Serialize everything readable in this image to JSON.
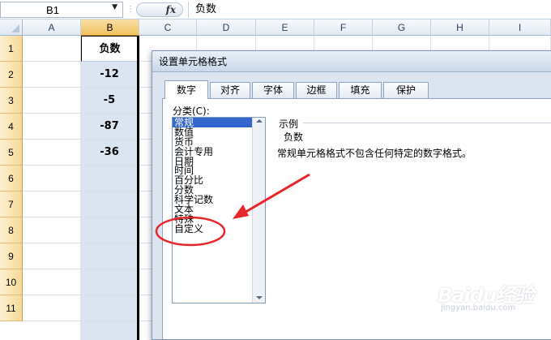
{
  "formula_bar": {
    "name_box": "B1",
    "fx_label": "fx",
    "value": "负数"
  },
  "columns": [
    "A",
    "B",
    "C",
    "D",
    "E",
    "F",
    "G",
    "H",
    "I"
  ],
  "rows": [
    "1",
    "2",
    "3",
    "4",
    "5",
    "6",
    "7",
    "8",
    "9",
    "10",
    "11"
  ],
  "cells": {
    "B1": "负数",
    "B2": "-12",
    "B3": "-5",
    "B4": "-87",
    "B5": "-36"
  },
  "dialog": {
    "title": "设置单元格格式",
    "tabs": [
      "数字",
      "对齐",
      "字体",
      "边框",
      "填充",
      "保护"
    ],
    "category_label": "分类(C):",
    "categories": [
      "常规",
      "数值",
      "货币",
      "会计专用",
      "日期",
      "时间",
      "百分比",
      "分数",
      "科学记数",
      "文本",
      "特殊",
      "自定义"
    ],
    "selected_category": "常规",
    "sample_label": "示例",
    "sample_value": "负数",
    "description": "常规单元格格式不包含任何特定的数字格式。"
  },
  "annotation_colors": {
    "circle": "#e8252a",
    "arrow": "#e8252a"
  },
  "watermark": {
    "brand": "Baidu经验",
    "url": "jingyan.baidu.com"
  }
}
